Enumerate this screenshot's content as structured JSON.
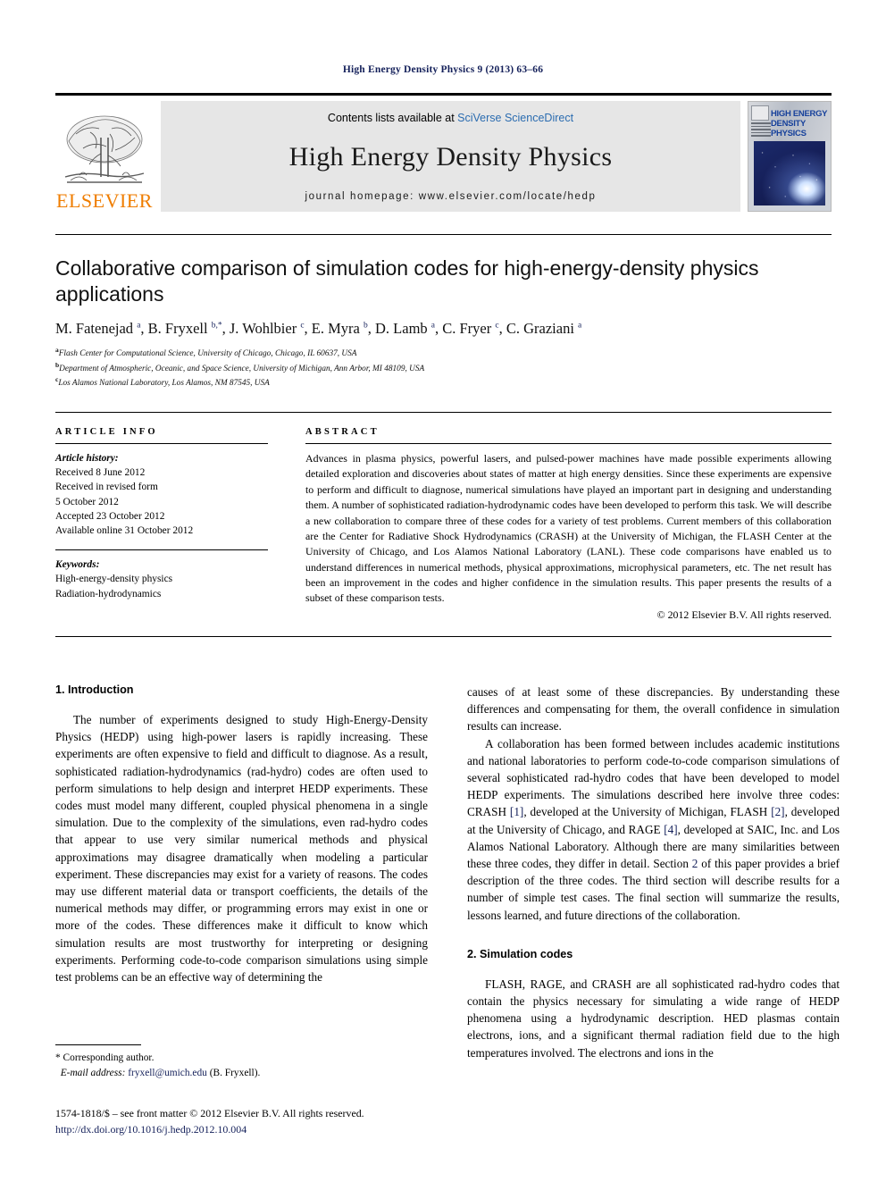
{
  "running_head": "High Energy Density Physics 9 (2013) 63–66",
  "masthead": {
    "publisher_name": "ELSEVIER",
    "contents_prefix": "Contents lists available at ",
    "contents_link": "SciVerse ScienceDirect",
    "journal_name": "High Energy Density Physics",
    "homepage_line": "journal homepage: www.elsevier.com/locate/hedp",
    "cover_title_line1": "HIGH ENERGY",
    "cover_title_line2": "DENSITY PHYSICS"
  },
  "article": {
    "title": "Collaborative comparison of simulation codes for high-energy-density physics applications",
    "authors_html": "M. Fatenejad <sup>a</sup>, B. Fryxell <sup>b,*</sup>, J. Wohlbier <sup>c</sup>, E. Myra <sup>b</sup>, D. Lamb <sup>a</sup>, C. Fryer <sup>c</sup>, C. Graziani <sup>a</sup>",
    "affiliations": [
      {
        "marker": "a",
        "text": "Flash Center for Computational Science, University of Chicago, Chicago, IL 60637, USA"
      },
      {
        "marker": "b",
        "text": "Department of Atmospheric, Oceanic, and Space Science, University of Michigan, Ann Arbor, MI 48109, USA"
      },
      {
        "marker": "c",
        "text": "Los Alamos National Laboratory, Los Alamos, NM 87545, USA"
      }
    ]
  },
  "article_info": {
    "heading": "ARTICLE INFO",
    "history_label": "Article history:",
    "history": [
      "Received 8 June 2012",
      "Received in revised form",
      "5 October 2012",
      "Accepted 23 October 2012",
      "Available online 31 October 2012"
    ],
    "keywords_label": "Keywords:",
    "keywords": [
      "High-energy-density physics",
      "Radiation-hydrodynamics"
    ]
  },
  "abstract": {
    "heading": "ABSTRACT",
    "text": "Advances in plasma physics, powerful lasers, and pulsed-power machines have made possible experiments allowing detailed exploration and discoveries about states of matter at high energy densities. Since these experiments are expensive to perform and difficult to diagnose, numerical simulations have played an important part in designing and understanding them. A number of sophisticated radiation-hydrodynamic codes have been developed to perform this task. We will describe a new collaboration to compare three of these codes for a variety of test problems. Current members of this collaboration are the Center for Radiative Shock Hydrodynamics (CRASH) at the University of Michigan, the FLASH Center at the University of Chicago, and Los Alamos National Laboratory (LANL). These code comparisons have enabled us to understand differences in numerical methods, physical approximations, microphysical parameters, etc. The net result has been an improvement in the codes and higher confidence in the simulation results. This paper presents the results of a subset of these comparison tests.",
    "copyright": "© 2012 Elsevier B.V. All rights reserved."
  },
  "sections": {
    "intro_heading": "1. Introduction",
    "intro_p1": "The number of experiments designed to study High-Energy-Density Physics (HEDP) using high-power lasers is rapidly increasing. These experiments are often expensive to field and difficult to diagnose. As a result, sophisticated radiation-hydrodynamics (rad-hydro) codes are often used to perform simulations to help design and interpret HEDP experiments. These codes must model many different, coupled physical phenomena in a single simulation. Due to the complexity of the simulations, even rad-hydro codes that appear to use very similar numerical methods and physical approximations may disagree dramatically when modeling a particular experiment. These discrepancies may exist for a variety of reasons. The codes may use different material data or transport coefficients, the details of the numerical methods may differ, or programming errors may exist in one or more of the codes. These differences make it difficult to know which simulation results are most trustworthy for interpreting or designing experiments. Performing code-to-code comparison simulations using simple test problems can be an effective way of determining the",
    "intro_p1_cont": "causes of at least some of these discrepancies. By understanding these differences and compensating for them, the overall confidence in simulation results can increase.",
    "intro_p2_a": "A collaboration has been formed between includes academic institutions and national laboratories to perform code-to-code comparison simulations of several sophisticated rad-hydro codes that have been developed to model HEDP experiments. The simulations described here involve three codes: CRASH ",
    "ref1": "[1]",
    "intro_p2_b": ", developed at the University of Michigan, FLASH ",
    "ref2": "[2]",
    "intro_p2_c": ", developed at the University of Chicago, and RAGE ",
    "ref4": "[4]",
    "intro_p2_d": ", developed at SAIC, Inc. and Los Alamos National Laboratory. Although there are many similarities between these three codes, they differ in detail. Section ",
    "ref_sec2": "2",
    "intro_p2_e": " of this paper provides a brief description of the three codes. The third section will describe results for a number of simple test cases. The final section will summarize the results, lessons learned, and future directions of the collaboration.",
    "sim_heading": "2. Simulation codes",
    "sim_p1": "FLASH, RAGE, and CRASH are all sophisticated rad-hydro codes that contain the physics necessary for simulating a wide range of HEDP phenomena using a hydrodynamic description. HED plasmas contain electrons, ions, and a significant thermal radiation field due to the high temperatures involved. The electrons and ions in the"
  },
  "footnote": {
    "corresponding": "* Corresponding author.",
    "email_label": "E-mail address:",
    "email": "fryxell@umich.edu",
    "email_suffix": "(B. Fryxell)."
  },
  "footer": {
    "issn_line": "1574-1818/$ – see front matter © 2012 Elsevier B.V. All rights reserved.",
    "doi": "http://dx.doi.org/10.1016/j.hedp.2012.10.004"
  },
  "colors": {
    "link_blue": "#2b6cb0",
    "dark_navy": "#14205a",
    "elsevier_orange": "#ef7d00",
    "band_gray": "#e6e6e6"
  }
}
